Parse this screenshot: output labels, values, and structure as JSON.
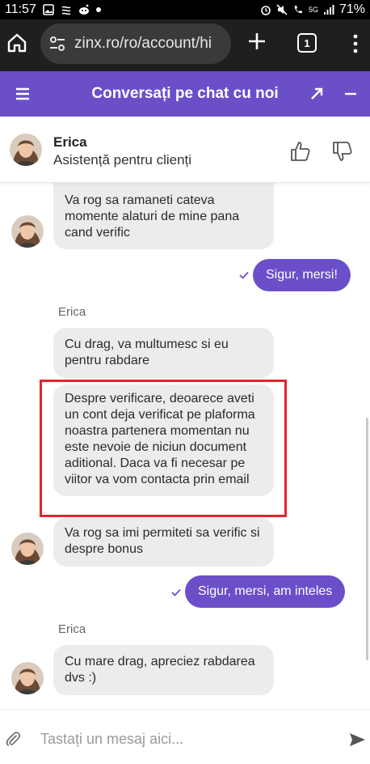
{
  "status_bar": {
    "time": "11:57",
    "battery": "71%",
    "network": "5G"
  },
  "browser": {
    "url": "zinx.ro/ro/account/hi",
    "tab_count": "1"
  },
  "chat_header": {
    "title": "Conversați pe chat cu noi"
  },
  "agent": {
    "name": "Erica",
    "role": "Asistență pentru clienți"
  },
  "messages": [
    {
      "id": "m1",
      "from": "agent",
      "text": "Va rog sa ramaneti cateva momente alaturi de mine pana cand verific"
    },
    {
      "id": "m2",
      "from": "user",
      "text": "Sigur, mersi!"
    },
    {
      "id": "m3",
      "from": "agent",
      "sender": "Erica",
      "text": "Cu drag, va multumesc si eu pentru rabdare"
    },
    {
      "id": "m4",
      "from": "agent",
      "text": "Despre verificare, deoarece aveti un cont deja verificat pe plaforma noastra partenera momentan nu este nevoie de niciun document aditional. Daca va fi necesar pe viitor va vom contacta prin email",
      "highlighted": true
    },
    {
      "id": "m5",
      "from": "agent",
      "text": "Va rog sa imi permiteti sa verific si despre bonus"
    },
    {
      "id": "m6",
      "from": "user",
      "text": "Sigur, mersi, am inteles"
    },
    {
      "id": "m7",
      "from": "agent",
      "sender": "Erica",
      "text": "Cu mare drag, apreciez rabdarea dvs :)"
    }
  ],
  "composer": {
    "placeholder": "Tastați un mesaj aici..."
  },
  "colors": {
    "brand": "#6b4fc9",
    "highlight": "#e0262e",
    "agent_bubble": "#ececec"
  }
}
